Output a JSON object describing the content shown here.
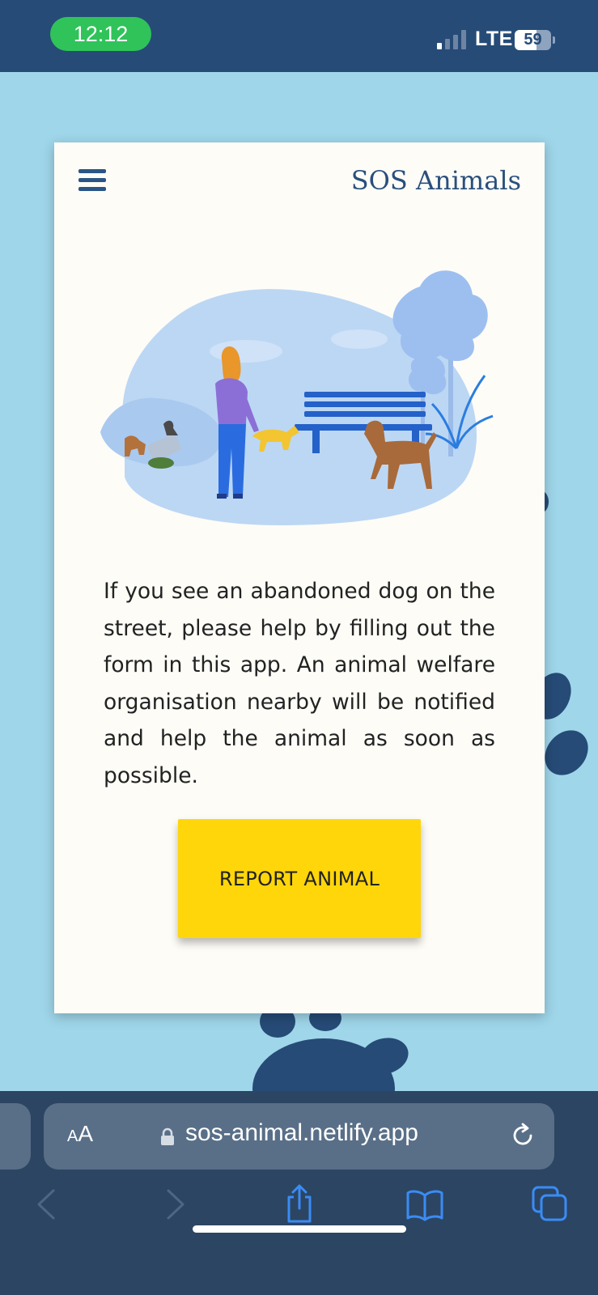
{
  "status_bar": {
    "time": "12:12",
    "network": "LTE",
    "battery": "59"
  },
  "app": {
    "title": "SOS Animals",
    "description": "If you see an abandoned dog on the street, please help by filling out the form in this app. An animal welfare organisation nearby will be notified and help the animal as soon as possible.",
    "report_button": "REPORT ANIMAL"
  },
  "browser": {
    "text_size_label_small": "A",
    "text_size_label_large": "A",
    "url": "sos-animal.netlify.app"
  },
  "colors": {
    "status_bar": "#264b77",
    "page_background": "#9fd6ea",
    "button": "#ffd60a",
    "brand_text": "#2a4f7c",
    "paw": "#264b77"
  },
  "icons": [
    "menu-icon",
    "lock-icon",
    "reload-icon",
    "back-icon",
    "forward-icon",
    "share-icon",
    "bookmarks-icon",
    "tabs-icon"
  ]
}
